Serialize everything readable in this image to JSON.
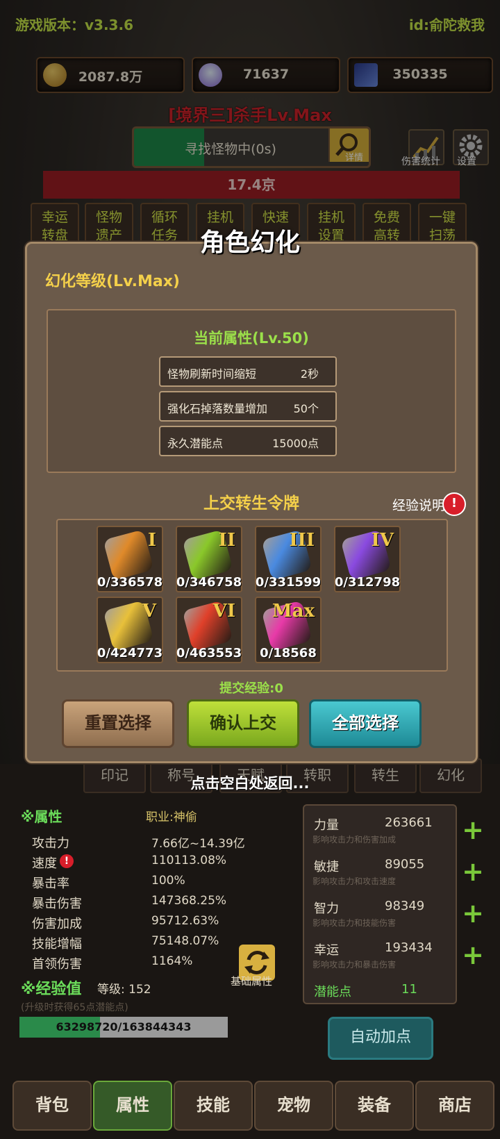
{
  "header": {
    "version_label": "游戏版本：v3.3.6",
    "user_id": "id:俞陀救我"
  },
  "resources": [
    {
      "icon": "coin-icon",
      "value": "2087.8万"
    },
    {
      "icon": "crystal-icon",
      "value": "71637"
    },
    {
      "icon": "card-icon",
      "value": "350335"
    }
  ],
  "character_title": "[境界三]杀手Lv.Max",
  "search": {
    "text": "寻找怪物中(0s)",
    "progress_percent": 30,
    "detail_label": "详情"
  },
  "tools": {
    "damage_stats_label": "伤害统计",
    "settings_label": "设置"
  },
  "damage_value": "17.4京",
  "nav_tiles": [
    "幸运\n转盘",
    "怪物\n遗产",
    "循环\n任务",
    "挂机",
    "快速",
    "挂机\n设置",
    "免费\n高转",
    "一键\n扫荡"
  ],
  "modal": {
    "title": "角色幻化",
    "level_label": "幻化等级(Lv.Max)",
    "current_attr_title": "当前属性(Lv.50)",
    "attributes": [
      {
        "name": "怪物刷新时间缩短",
        "value": "2秒"
      },
      {
        "name": "强化石掉落数量增加",
        "value": "50个"
      },
      {
        "name": "永久潜能点",
        "value": "15000点"
      }
    ],
    "submit_title": "上交转生令牌",
    "exp_help_label": "经验说明",
    "exp_help_icon": "!",
    "tokens": [
      {
        "tier": "I",
        "count": "0/336578",
        "color": "#e08a2a"
      },
      {
        "tier": "II",
        "count": "0/346758",
        "color": "#8ac82a"
      },
      {
        "tier": "III",
        "count": "0/331599",
        "color": "#4a8ae0"
      },
      {
        "tier": "IV",
        "count": "0/312798",
        "color": "#8a4ae0"
      },
      {
        "tier": "V",
        "count": "0/424773",
        "color": "#e8c03a"
      },
      {
        "tier": "VI",
        "count": "0/463553",
        "color": "#e0402a"
      },
      {
        "tier": "Max",
        "count": "0/18568",
        "color": "#e83aa8"
      }
    ],
    "submit_exp": "提交经验:0",
    "buttons": {
      "reset": "重置选择",
      "confirm": "确认上交",
      "select_all": "全部选择"
    }
  },
  "return_hint": "点击空白处返回...",
  "tab_strip": [
    "印记",
    "称号",
    "天赋",
    "转职",
    "转生",
    "幻化"
  ],
  "stats": {
    "heading": "※属性",
    "job": "职业:神偷",
    "rows": [
      {
        "name": "攻击力",
        "value": "7.66亿~14.39亿"
      },
      {
        "name": "速度",
        "value": "110113.08%"
      },
      {
        "name": "暴击率",
        "value": "100%"
      },
      {
        "name": "暴击伤害",
        "value": "147368.25%"
      },
      {
        "name": "伤害加成",
        "value": "95712.63%"
      },
      {
        "name": "技能增幅",
        "value": "75148.07%"
      },
      {
        "name": "首领伤害",
        "value": "1164%"
      }
    ],
    "speed_warning_icon": "!",
    "base_attr_label": "基础属性",
    "exp_heading": "※经验值",
    "level_label": "等级: 152",
    "exp_hint": "(升级时获得65点潜能点)",
    "exp_text": "63298720/163844343",
    "exp_percent": 38.6
  },
  "alloc": [
    {
      "name": "力量",
      "value": "263661",
      "desc": "影响攻击力和伤害加成"
    },
    {
      "name": "敏捷",
      "value": "89055",
      "desc": "影响攻击力和攻击速度"
    },
    {
      "name": "智力",
      "value": "98349",
      "desc": "影响攻击力和技能伤害"
    },
    {
      "name": "幸运",
      "value": "193434",
      "desc": "影响攻击力和暴击伤害"
    }
  ],
  "potential": {
    "label": "潜能点",
    "value": "11"
  },
  "auto_add_label": "自动加点",
  "bottom_nav": [
    "背包",
    "属性",
    "技能",
    "宠物",
    "装备",
    "商店"
  ]
}
